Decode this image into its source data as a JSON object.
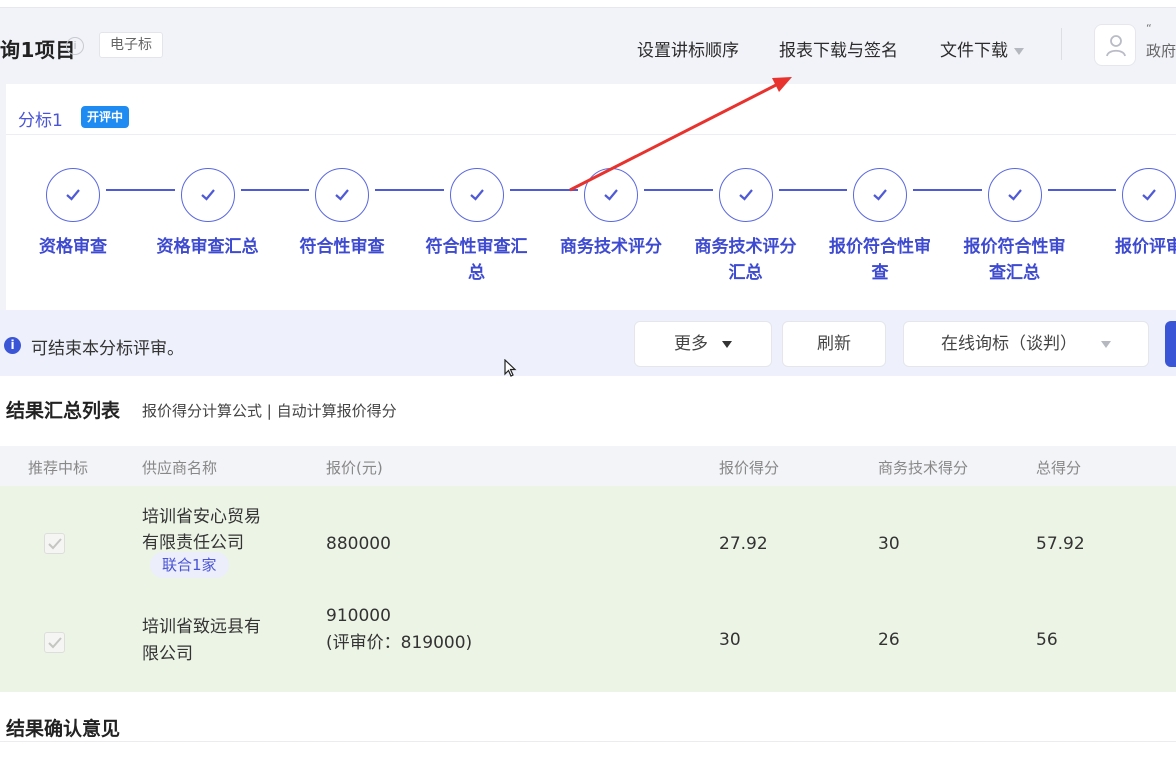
{
  "header": {
    "project_title": "询1项目",
    "type_tag": "电子标",
    "links": [
      "设置讲标顺序",
      "报表下载与签名",
      "文件下载"
    ],
    "user_top_text": "“",
    "user_text": "政府"
  },
  "tabs": {
    "active": "分标1",
    "status": "开评中"
  },
  "steps": [
    {
      "label": "资格审查"
    },
    {
      "label": "资格审查汇总"
    },
    {
      "label": "符合性审查"
    },
    {
      "label": "符合性审查汇总"
    },
    {
      "label": "商务技术评分"
    },
    {
      "label": "商务技术评分汇总"
    },
    {
      "label": "报价符合性审查"
    },
    {
      "label": "报价符合性审查汇总"
    },
    {
      "label": "报价评审"
    }
  ],
  "notice": {
    "icon": "i",
    "text": "可结束本分标评审。",
    "more_label": "更多",
    "refresh_label": "刷新",
    "select_value": "在线询标（谈判）"
  },
  "summary": {
    "title": "结果汇总列表",
    "subtitle": "报价得分计算公式 | 自动计算报价得分",
    "columns": [
      "推荐中标",
      "供应商名称",
      "报价(元)",
      "报价得分",
      "商务技术得分",
      "总得分"
    ],
    "rows": [
      {
        "name_line1": "培训省安心贸易",
        "name_line2": "有限责任公司",
        "tag": "联合1家",
        "price_line1": "880000",
        "price_line2": "",
        "price_score": "27.92",
        "tech_score": "30",
        "total": "57.92"
      },
      {
        "name_line1": "培训省致远县有",
        "name_line2": "限公司",
        "tag": "",
        "price_line1": "910000",
        "price_line2": "(评审价：819000)",
        "price_score": "30",
        "tech_score": "26",
        "total": "56"
      }
    ]
  },
  "confirm": {
    "title": "结果确认意见"
  },
  "colors": {
    "accent": "#4e5ad6",
    "status_blue": "#1d8bf1",
    "row_green": "#ecf4e6",
    "annotation_red": "#e8322d"
  }
}
